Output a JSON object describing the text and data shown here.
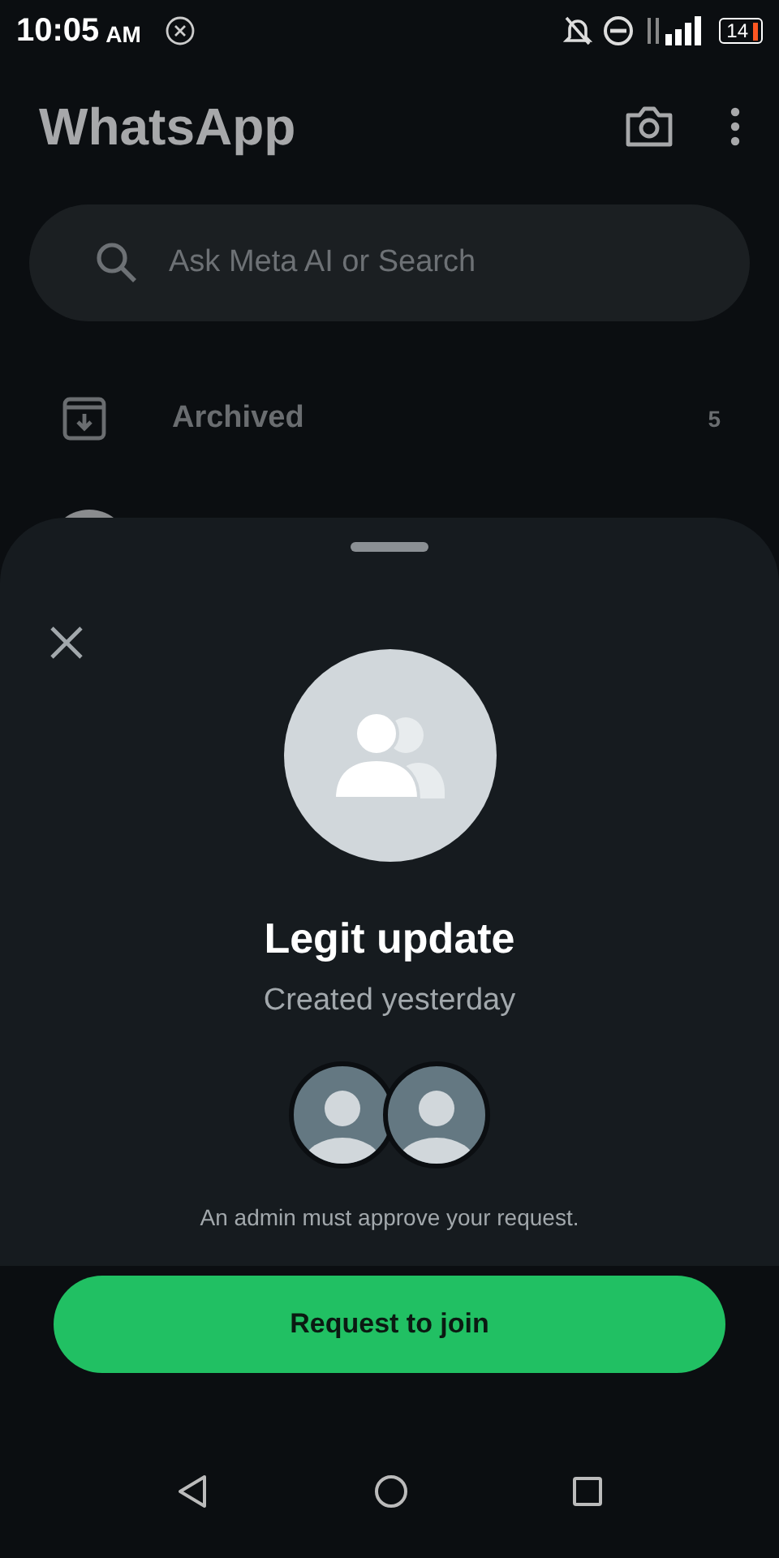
{
  "status_bar": {
    "time": "10:05",
    "period": "AM",
    "battery": "14"
  },
  "header": {
    "title": "WhatsApp"
  },
  "search": {
    "placeholder": "Ask Meta AI or Search"
  },
  "archived": {
    "label": "Archived",
    "count": "5"
  },
  "sheet": {
    "group_name": "Legit update",
    "subtitle": "Created yesterday",
    "members": [
      {
        "kind": "avatar"
      },
      {
        "kind": "avatar"
      }
    ],
    "note": "An admin must approve your request.",
    "button": "Request to join"
  }
}
